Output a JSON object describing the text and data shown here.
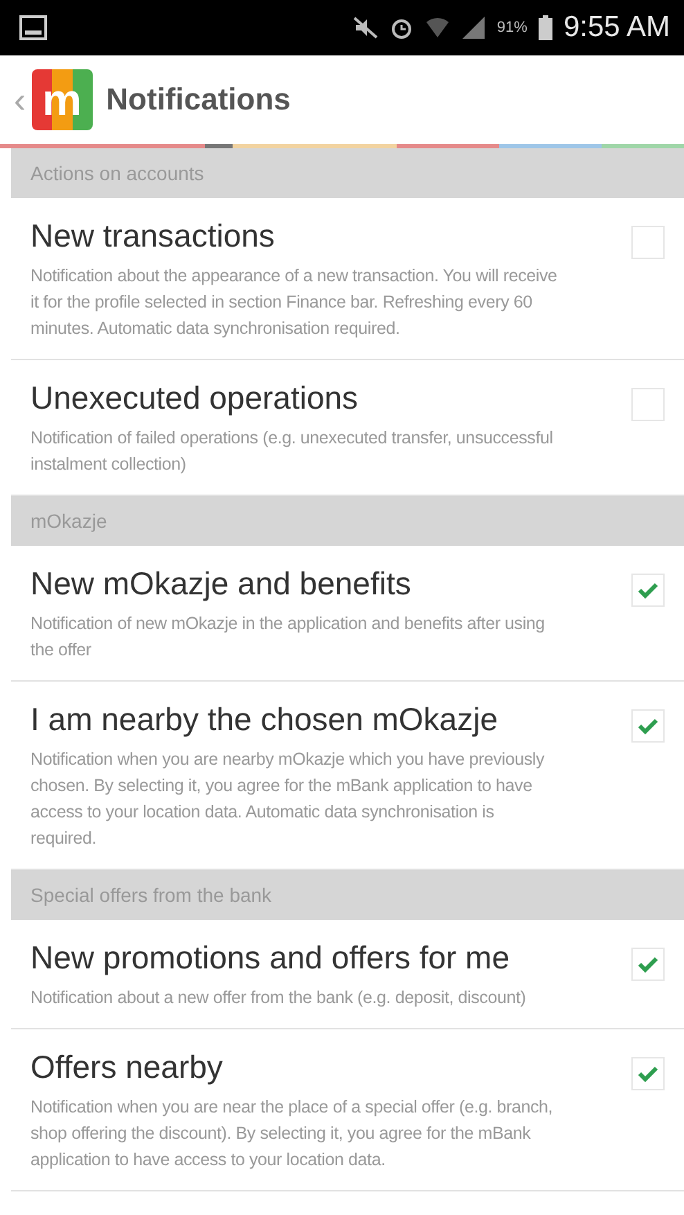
{
  "status_bar": {
    "battery_text": "91%",
    "time": "9:55 AM"
  },
  "app_bar": {
    "back": "‹",
    "logo": "m",
    "title": "Notifications"
  },
  "sections": [
    {
      "header": "Actions on accounts",
      "items": [
        {
          "title": "New transactions",
          "description": "Notification about the appearance of a new transaction. You will receive it for the profile selected in section Finance bar. Refreshing every 60 minutes. Automatic data synchronisation required.",
          "checked": false
        },
        {
          "title": "Unexecuted operations",
          "description": "Notification of failed operations (e.g. unexecuted transfer, unsuccessful instalment collection)",
          "checked": false
        }
      ]
    },
    {
      "header": "mOkazje",
      "items": [
        {
          "title": "New mOkazje and benefits",
          "description": "Notification of new mOkazje in the application and benefits after using the offer",
          "checked": true
        },
        {
          "title": "I am nearby the chosen mOkazje",
          "description": "Notification when you are nearby mOkazje which you have previously chosen. By selecting it, you agree for the mBank application to have access to your location data. Automatic data synchronisation is required.",
          "checked": true
        }
      ]
    },
    {
      "header": "Special offers from the bank",
      "items": [
        {
          "title": "New promotions and offers for me",
          "description": "Notification about a new offer from the bank (e.g. deposit, discount)",
          "checked": true
        },
        {
          "title": "Offers nearby",
          "description": "Notification when you are near the place of a special offer (e.g. branch, shop offering the discount). By selecting it, you agree for the mBank application to have access to your location data.",
          "checked": true
        }
      ]
    }
  ]
}
